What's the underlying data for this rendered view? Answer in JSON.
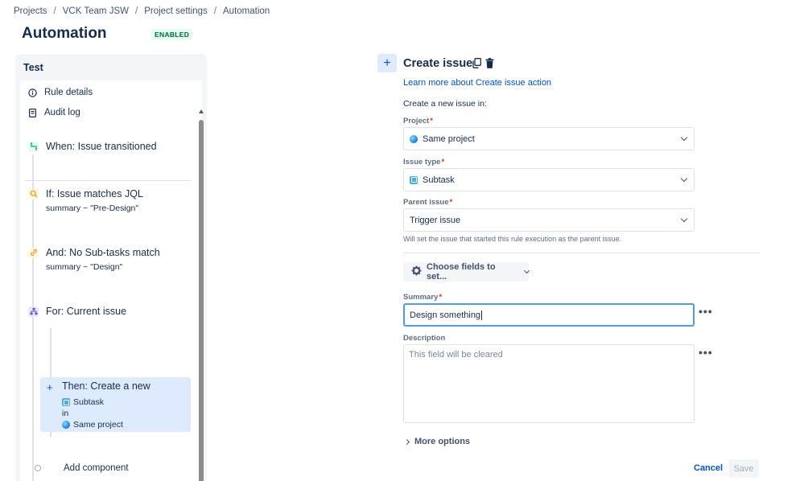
{
  "breadcrumb": [
    "Projects",
    "VCK Team JSW",
    "Project settings",
    "Automation"
  ],
  "page": {
    "title": "Automation",
    "status": "ENABLED"
  },
  "rule": {
    "name": "Test",
    "links": [
      {
        "label": "Rule details",
        "icon": "info-icon"
      },
      {
        "label": "Audit log",
        "icon": "audit-log-icon"
      }
    ],
    "components": [
      {
        "title": "When: Issue transitioned",
        "sub": "",
        "icon": "transition-icon",
        "color": "#36b37e"
      },
      {
        "title": "If: Issue matches JQL",
        "sub": "summary ~ \"Pre-Design\"",
        "icon": "search-icon",
        "color": "#ff991f"
      },
      {
        "title": "And: No Sub-tasks match",
        "sub": "summary ~ \"Design\"",
        "icon": "link-icon",
        "color": "#ff991f"
      },
      {
        "title": "For: Current issue",
        "sub": "",
        "icon": "branch-icon",
        "color": "#6554c0"
      }
    ],
    "action": {
      "title": "Then: Create a new",
      "type": "Subtask",
      "in": "in",
      "project": "Same project"
    },
    "add_component": "Add component"
  },
  "form": {
    "title": "Create issue",
    "learn_more": "Learn more about Create issue action",
    "create_in": "Create a new issue in:",
    "project": {
      "label": "Project",
      "value": "Same project"
    },
    "issue_type": {
      "label": "Issue type",
      "value": "Subtask"
    },
    "parent_issue": {
      "label": "Parent issue",
      "value": "Trigger issue",
      "helper": "Will set the issue that started this rule execution as the parent issue."
    },
    "choose_fields": "Choose fields to set...",
    "summary": {
      "label": "Summary",
      "value": "Design something"
    },
    "description": {
      "label": "Description",
      "placeholder": "This field will be cleared"
    },
    "more_options": "More options",
    "cancel": "Cancel",
    "save": "Save"
  },
  "colors": {
    "accent": "#0052cc",
    "selected_bg": "#deebff",
    "focus": "#4c9aff"
  }
}
